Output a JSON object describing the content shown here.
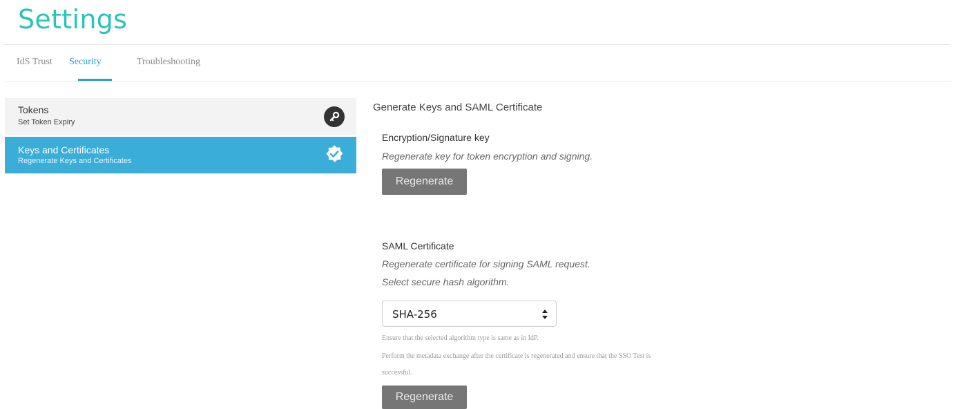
{
  "header": {
    "title": "Settings"
  },
  "tabs": [
    {
      "label": "IdS Trust",
      "active": false
    },
    {
      "label": "Security",
      "active": true
    },
    {
      "label": "Troubleshooting",
      "active": false
    }
  ],
  "sidebar": {
    "items": [
      {
        "title": "Tokens",
        "subtitle": "Set Token Expiry",
        "icon": "key-icon",
        "selected": false
      },
      {
        "title": "Keys and Certificates",
        "subtitle": "Regenerate Keys and Certificates",
        "icon": "verified-badge-icon",
        "selected": true
      }
    ]
  },
  "main": {
    "section_title": "Generate Keys and SAML Certificate",
    "encryption": {
      "label": "Encryption/Signature key",
      "description": "Regenerate key for token encryption and signing.",
      "button_label": "Regenerate"
    },
    "saml": {
      "label": "SAML Certificate",
      "description1": "Regenerate certificate for signing SAML request.",
      "description2": "Select secure hash algorithm.",
      "hash_select": {
        "value": "SHA-256"
      },
      "note1": "Ensure that the selected algorithm type is same as in IdP.",
      "note2_line1": "Perform the metadata exchange after the certificate is regenerated and ensure that the SSO Test is",
      "note2_line2": "successful.",
      "button_label": "Regenerate"
    }
  },
  "colors": {
    "accent_title": "#2bc3b8",
    "tab_active": "#2b9fd1",
    "sidebar_selected": "#3aaed8",
    "button_bg": "#767676"
  }
}
